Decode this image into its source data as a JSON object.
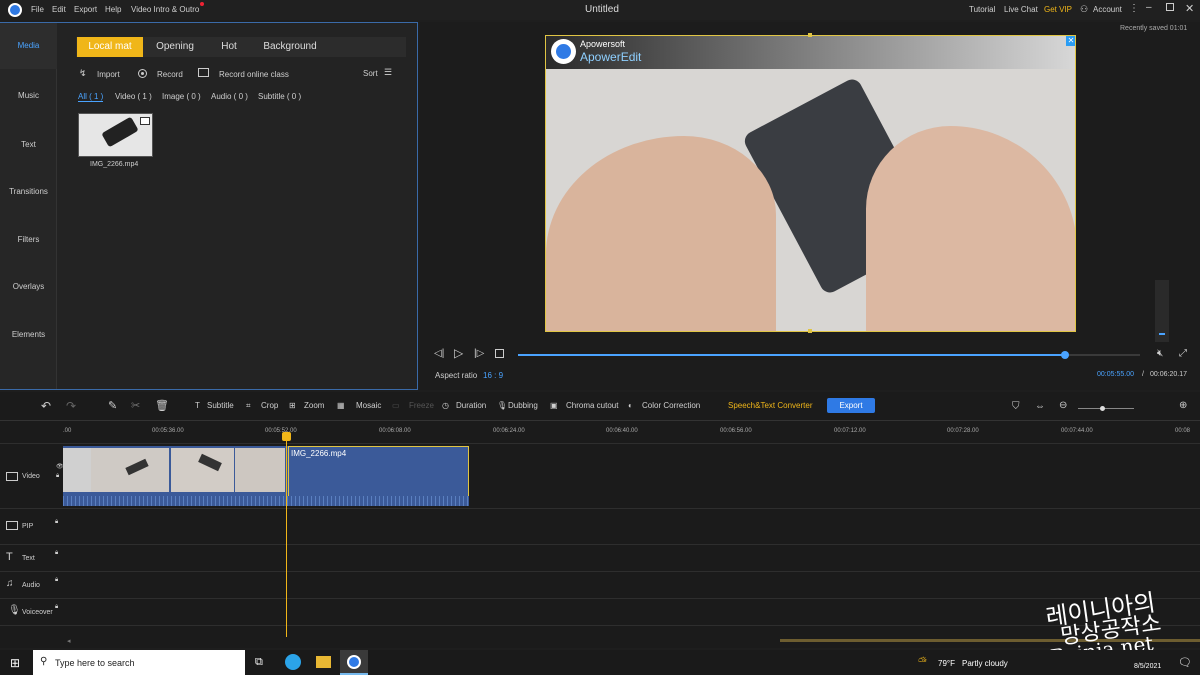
{
  "titlebar": {
    "menus": [
      "File",
      "Edit",
      "Export",
      "Help",
      "Video Intro & Outro"
    ],
    "doc_title": "Untitled",
    "links": [
      "Tutorial",
      "Live Chat",
      "Get VIP",
      "Account"
    ]
  },
  "sidebar": [
    "Media",
    "Music",
    "Text",
    "Transitions",
    "Filters",
    "Overlays",
    "Elements"
  ],
  "media_tabs": [
    "Local mat",
    "Opening",
    "Hot",
    "Background"
  ],
  "media_actions": {
    "import": "Import",
    "record": "Record",
    "record_online": "Record online class",
    "sort": "Sort"
  },
  "filters": [
    "All ( 1 )",
    "Video ( 1 )",
    "Image ( 0 )",
    "Audio ( 0 )",
    "Subtitle ( 0 )"
  ],
  "media_item": {
    "name": "IMG_2266.mp4"
  },
  "preview": {
    "saved": "Recently saved 01:01",
    "watermark_brand": "Apowersoft",
    "watermark_product": "ApowerEdit",
    "aspect_label": "Aspect ratio",
    "aspect_value": "16 : 9",
    "time_current": "00:05:55.00",
    "time_sep": "/",
    "time_total": "00:06:20.17",
    "progress": 0.88
  },
  "toolbar": [
    "Subtitle",
    "Crop",
    "Zoom",
    "Mosaic",
    "Freeze",
    "Duration",
    "Dubbing",
    "Chroma cutout",
    "Color Correction"
  ],
  "speech": "Speech&Text Converter",
  "export": "Export",
  "ruler": [
    ".00",
    "00:05:36.00",
    "00:05:52.00",
    "00:06:08.00",
    "00:06:24.00",
    "00:06:40.00",
    "00:06:56.00",
    "00:07:12.00",
    "00:07:28.00",
    "00:07:44.00",
    "00:08"
  ],
  "tracks": [
    "Video",
    "PIP",
    "Text",
    "Audio",
    "Voiceover"
  ],
  "clip": {
    "name": "IMG_2266.mp4"
  },
  "taskbar": {
    "search": "Type here to search",
    "weather_temp": "79°F",
    "weather_desc": "Partly cloudy",
    "date": "8/5/2021"
  },
  "overlay_text": {
    "line1": "레이니아의",
    "line2": "망상공작소",
    "line3": "Reinia.net"
  },
  "colors": {
    "accent": "#f0b619",
    "blue": "#2f7ae5",
    "selection": "#e0c544"
  }
}
